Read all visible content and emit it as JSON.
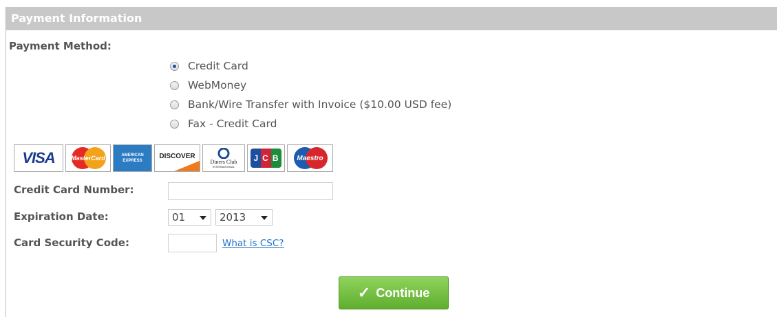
{
  "header": {
    "title": "Payment Information"
  },
  "payment_method": {
    "label": "Payment Method:",
    "options": [
      {
        "label": "Credit Card",
        "selected": true
      },
      {
        "label": "WebMoney",
        "selected": false
      },
      {
        "label": "Bank/Wire Transfer with Invoice ($10.00 USD fee)",
        "selected": false
      },
      {
        "label": "Fax - Credit Card",
        "selected": false
      }
    ]
  },
  "cards": {
    "visa": "VISA",
    "mastercard": "MasterCard",
    "amex": "AMERICAN EXPRESS",
    "discover": "DISCOVER",
    "diners": "Diners Club",
    "diners_sub": "INTERNATIONAL",
    "jcb": "JCB",
    "maestro": "Maestro"
  },
  "form": {
    "card_number_label": "Credit Card Number:",
    "card_number_value": "",
    "expiration_label": "Expiration Date:",
    "exp_month": "01",
    "exp_year": "2013",
    "csc_label": "Card Security Code:",
    "csc_value": "",
    "csc_link": "What is CSC?"
  },
  "actions": {
    "continue_label": "Continue"
  },
  "colors": {
    "header_bg": "#c8c8c8",
    "button_green": "#6cbf3a",
    "link_blue": "#1e72c8"
  }
}
